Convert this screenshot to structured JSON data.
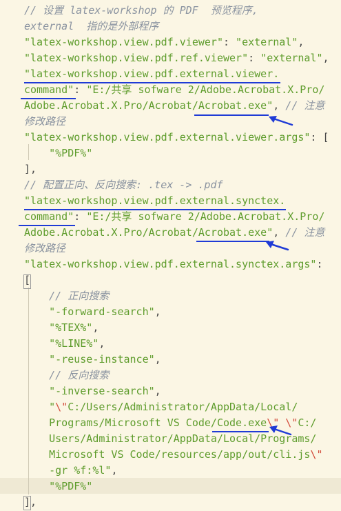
{
  "lines": [
    {
      "y": 0,
      "segs": [
        {
          "x": 35,
          "c": "cm",
          "t": "// 设置 latex-workshop 的 PDF  预览程序,"
        }
      ]
    },
    {
      "y": 0,
      "segs": [
        {
          "x": 35,
          "c": "cm",
          "t": "external  指的是外部程序"
        }
      ]
    },
    {
      "y": 0,
      "segs": [
        {
          "x": 35,
          "c": "key",
          "t": "\"latex-workshop.view.pdf.viewer\""
        },
        {
          "x": 35,
          "c": "pun",
          "t": ""
        },
        {
          "x": 35,
          "c": "pun",
          "t": ""
        }
      ]
    },
    {
      "y": 0,
      "segs": []
    }
  ],
  "code": [
    [
      {
        "c": "cm",
        "t": "// 设置 latex-workshop 的 PDF  预览程序,"
      }
    ],
    [
      {
        "c": "cm",
        "t": "external  指的是外部程序"
      }
    ],
    [
      {
        "c": "key",
        "t": "\"latex-workshop.view.pdf.viewer\""
      },
      {
        "c": "pun",
        "t": ": "
      },
      {
        "c": "str",
        "t": "\"external\""
      },
      {
        "c": "pun",
        "t": ","
      }
    ],
    [
      {
        "c": "key",
        "t": "\"latex-workshop.view.pdf.ref.viewer\""
      },
      {
        "c": "pun",
        "t": ": "
      },
      {
        "c": "str",
        "t": "\"external\""
      },
      {
        "c": "pun",
        "t": ","
      }
    ],
    [
      {
        "c": "key",
        "t": "\"latex-workshop.view.pdf.external.viewer."
      }
    ],
    [
      {
        "c": "key",
        "t": "command\""
      },
      {
        "c": "pun",
        "t": ": "
      },
      {
        "c": "str",
        "t": "\"E:/共享 sofware 2/Adobe.Acrobat.X.Pro/"
      }
    ],
    [
      {
        "c": "str",
        "t": "Adobe.Acrobat.X.Pro/Acrobat/Acrobat.exe\""
      },
      {
        "c": "pun",
        "t": ", "
      },
      {
        "c": "cm",
        "t": "// 注意"
      }
    ],
    [
      {
        "c": "cm",
        "t": "修改路径"
      }
    ],
    [
      {
        "c": "key",
        "t": "\"latex-workshop.view.pdf.external.viewer.args\""
      },
      {
        "c": "pun",
        "t": ": ["
      }
    ],
    [
      {
        "c": "pun",
        "t": "    "
      },
      {
        "c": "str",
        "t": "\"%PDF%\""
      }
    ],
    [
      {
        "c": "pun",
        "t": "],"
      }
    ],
    [
      {
        "c": "cm",
        "t": "// 配置正向、反向搜索: .tex -> .pdf"
      }
    ],
    [
      {
        "c": "key",
        "t": "\"latex-workshop.view.pdf.external.synctex."
      }
    ],
    [
      {
        "c": "key",
        "t": "command\""
      },
      {
        "c": "pun",
        "t": ": "
      },
      {
        "c": "str",
        "t": "\"E:/共享 sofware 2/Adobe.Acrobat.X.Pro/"
      }
    ],
    [
      {
        "c": "str",
        "t": "Adobe.Acrobat.X.Pro/Acrobat/Acrobat.exe\""
      },
      {
        "c": "pun",
        "t": ", "
      },
      {
        "c": "cm",
        "t": "// 注意"
      }
    ],
    [
      {
        "c": "cm",
        "t": "修改路径"
      }
    ],
    [
      {
        "c": "key",
        "t": "\"latex-workshop.view.pdf.external.synctex.args\""
      },
      {
        "c": "pun",
        "t": ":"
      }
    ],
    [
      {
        "c": "pun",
        "t": "["
      }
    ],
    [
      {
        "c": "pun",
        "t": "    "
      },
      {
        "c": "cm",
        "t": "// 正向搜索"
      }
    ],
    [
      {
        "c": "pun",
        "t": "    "
      },
      {
        "c": "str",
        "t": "\"-forward-search\""
      },
      {
        "c": "pun",
        "t": ","
      }
    ],
    [
      {
        "c": "pun",
        "t": "    "
      },
      {
        "c": "str",
        "t": "\"%TEX%\""
      },
      {
        "c": "pun",
        "t": ","
      }
    ],
    [
      {
        "c": "pun",
        "t": "    "
      },
      {
        "c": "str",
        "t": "\"%LINE%\""
      },
      {
        "c": "pun",
        "t": ","
      }
    ],
    [
      {
        "c": "pun",
        "t": "    "
      },
      {
        "c": "str",
        "t": "\"-reuse-instance\""
      },
      {
        "c": "pun",
        "t": ","
      }
    ],
    [
      {
        "c": "pun",
        "t": "    "
      },
      {
        "c": "cm",
        "t": "// 反向搜索"
      }
    ],
    [
      {
        "c": "pun",
        "t": "    "
      },
      {
        "c": "str",
        "t": "\"-inverse-search\""
      },
      {
        "c": "pun",
        "t": ","
      }
    ],
    [
      {
        "c": "pun",
        "t": "    "
      },
      {
        "c": "str",
        "t": "\""
      },
      {
        "c": "esc",
        "t": "\\\""
      },
      {
        "c": "str",
        "t": "C:/Users/Administrator/AppData/Local/"
      }
    ],
    [
      {
        "c": "pun",
        "t": "    "
      },
      {
        "c": "str",
        "t": "Programs/Microsoft VS Code/Code.exe"
      },
      {
        "c": "esc",
        "t": "\\\""
      },
      {
        "c": "str",
        "t": " "
      },
      {
        "c": "esc",
        "t": "\\\""
      },
      {
        "c": "str",
        "t": "C:/"
      }
    ],
    [
      {
        "c": "pun",
        "t": "    "
      },
      {
        "c": "str",
        "t": "Users/Administrator/AppData/Local/Programs/"
      }
    ],
    [
      {
        "c": "pun",
        "t": "    "
      },
      {
        "c": "str",
        "t": "Microsoft VS Code/resources/app/out/cli.js"
      },
      {
        "c": "esc",
        "t": "\\\""
      }
    ],
    [
      {
        "c": "pun",
        "t": "    "
      },
      {
        "c": "str",
        "t": "-gr %f:%l\""
      },
      {
        "c": "pun",
        "t": ","
      }
    ],
    [
      {
        "c": "pun",
        "t": "    "
      },
      {
        "c": "str",
        "t": "\"%PDF%\""
      }
    ],
    [
      {
        "c": "pun",
        "t": "],"
      }
    ]
  ],
  "colors": {
    "background": "#fbf6e4",
    "comment": "#8a93a0",
    "string": "#5e9c2c",
    "escape": "#d34b3a",
    "annotation": "#1f3bd6"
  }
}
